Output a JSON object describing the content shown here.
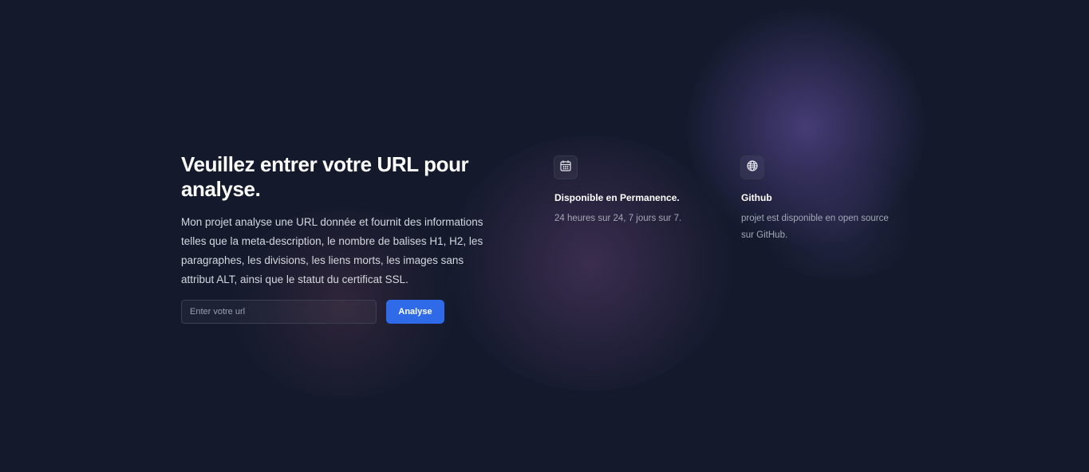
{
  "hero": {
    "title": "Veuillez entrer votre URL pour analyse.",
    "description": "Mon projet analyse une URL donnée et fournit des informations telles que la meta-description, le nombre de balises H1, H2, les paragraphes, les divisions, les liens morts, les images sans attribut ALT, ainsi que le statut du certificat SSL."
  },
  "form": {
    "url_value": "",
    "url_placeholder": "Enter votre url",
    "submit_label": "Analyse"
  },
  "features": [
    {
      "icon": "calendar-icon",
      "title": "Disponible en Permanence.",
      "description": "24 heures sur 24, 7 jours sur 7."
    },
    {
      "icon": "globe-icon",
      "title": "Github",
      "description": "projet est disponible en open source sur GitHub."
    }
  ],
  "colors": {
    "background": "#141a2c",
    "accent": "#2f6ae8",
    "text_primary": "#ffffff",
    "text_secondary": "#a4a8b6"
  }
}
